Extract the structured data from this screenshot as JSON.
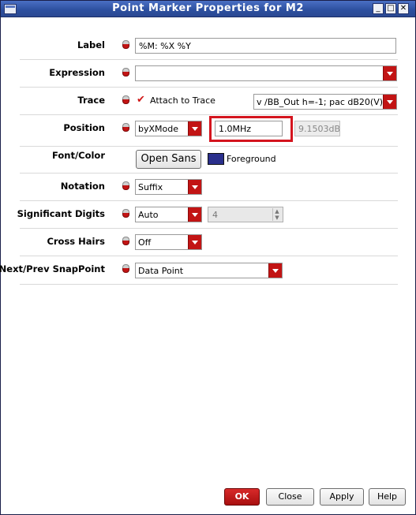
{
  "window": {
    "title": "Point Marker Properties for M2",
    "minimize_glyph": "_",
    "maximize_glyph": "□",
    "close_glyph": "✕"
  },
  "fields": {
    "label": {
      "label": "Label",
      "value": "%M: %X %Y"
    },
    "expression": {
      "label": "Expression",
      "value": ""
    },
    "trace": {
      "label": "Trace",
      "attach_checked": true,
      "attach_label": "Attach to Trace",
      "value": "v /BB_Out h=-1; pac dB20(V)"
    },
    "position": {
      "label": "Position",
      "mode": "byXMode",
      "x_value": "1.0MHz",
      "y_value": "9.1503dB"
    },
    "font_color": {
      "label": "Font/Color",
      "font_button": "Open Sans",
      "swatch_color": "#2a2f8c",
      "color_label": "Foreground"
    },
    "notation": {
      "label": "Notation",
      "value": "Suffix"
    },
    "significant_digits": {
      "label": "Significant Digits",
      "mode": "Auto",
      "value": "4"
    },
    "cross_hairs": {
      "label": "Cross Hairs",
      "value": "Off"
    },
    "snap_point": {
      "label": "Next/Prev SnapPoint",
      "value": "Data Point"
    }
  },
  "buttons": {
    "ok": "OK",
    "close": "Close",
    "apply": "Apply",
    "help": "Help"
  },
  "checkmark_glyph": "✔"
}
